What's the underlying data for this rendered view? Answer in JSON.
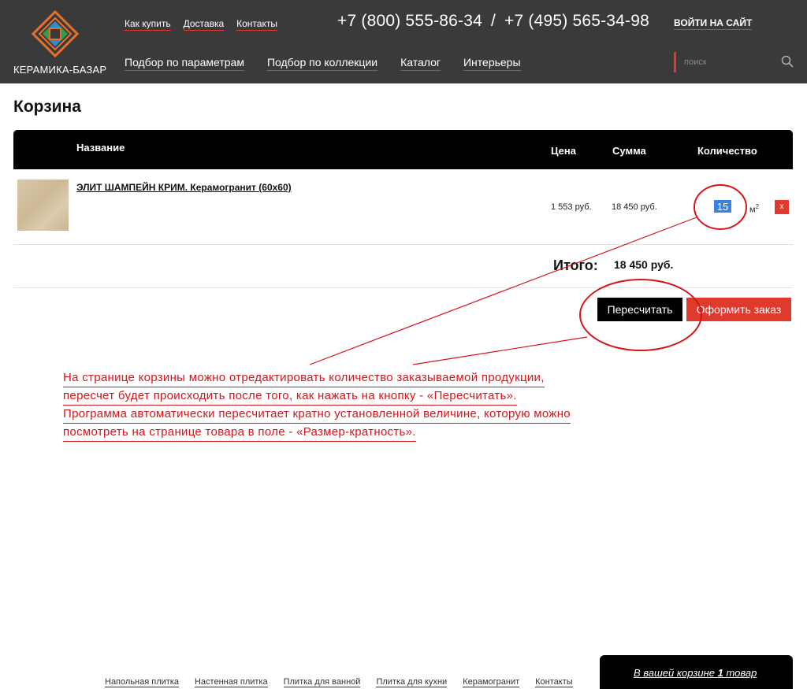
{
  "brand": {
    "logo_text": "КЕРАМИКА-БАЗАР",
    "colors": {
      "accent": "#e03a2f",
      "header_bg": "#3a3a3a",
      "logo_orange": "#e8702a",
      "logo_green": "#2f9e4a",
      "logo_blue": "#2a8fd0"
    }
  },
  "header": {
    "top_links": [
      "Как купить",
      "Доставка",
      "Контакты"
    ],
    "phone_1": "+7 (800) 555-86-34",
    "phone_sep": "/",
    "phone_2": "+7 (495) 565-34-98",
    "login": "ВОЙТИ НА САЙТ",
    "nav": [
      "Подбор по параметрам",
      "Подбор по коллекции",
      "Каталог",
      "Интерьеры"
    ],
    "search_placeholder": "поиск",
    "search_icon": "search-icon"
  },
  "cart": {
    "title": "Корзина",
    "columns": {
      "name": "Название",
      "price": "Цена",
      "sum": "Сумма",
      "qty": "Количество"
    },
    "items": [
      {
        "name": "ЭЛИТ ШАМПЕЙН КРИМ. Керамогранит (60x60)",
        "price": "1 553 руб.",
        "sum": "18 450 руб.",
        "qty": "15",
        "unit": "м",
        "unit_sup": "2",
        "remove_label": "x"
      }
    ],
    "total_label": "Итого:",
    "total_value": "18 450 руб.",
    "recalc_label": "Пересчитать",
    "order_label": "Оформить заказ"
  },
  "annotation": {
    "color": "#d8141b",
    "lines": [
      "На странице корзины можно отредактировать количество заказываемой продукции,",
      "пересчет будет происходить после того, как нажать на кнопку - «Пересчитать».",
      "Программа автоматически пересчитает кратно установленной величине, которую можно",
      "посмотреть на странице товара в поле - «Размер-кратность»."
    ]
  },
  "footer": {
    "links": [
      "Напольная плитка",
      "Настенная плитка",
      "Плитка для ванной",
      "Плитка для кухни",
      "Керамогранит",
      "Контакты"
    ],
    "cart_text_before": "В вашей корзине ",
    "cart_count": "1",
    "cart_text_after": " товар"
  }
}
